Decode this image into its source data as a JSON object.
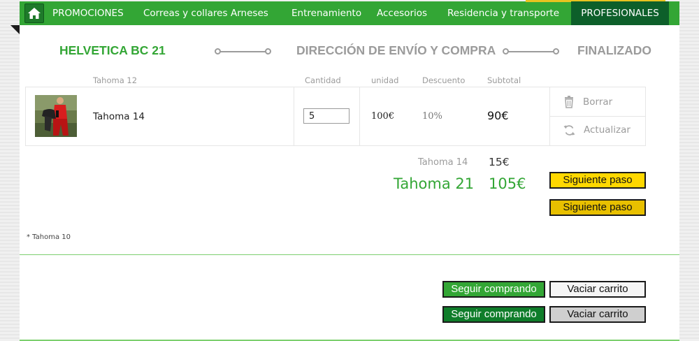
{
  "nav": {
    "home_icon": "home-icon",
    "items": [
      "PROMOCIONES",
      "Correas y collares",
      "Arneses",
      "Entrenamiento",
      "Accesorios",
      "Residencia y transporte"
    ],
    "professional": "PROFESIONALES",
    "colors": {
      "bar": "#33a635",
      "professional_bg": "#0d5f2a"
    }
  },
  "steps": {
    "step1": "HELVETICA BC 21",
    "step2": "DIRECCIÓN DE ENVÍO Y COMPRA",
    "step3": "FINALIZADO",
    "active_color": "#33a635",
    "inactive_color": "#9b9b9b"
  },
  "table": {
    "headers": {
      "product": "Tahoma 12",
      "quantity": "Cantidad",
      "unit": "unidad",
      "discount": "Descuento",
      "subtotal": "Subtotal"
    },
    "row": {
      "name": "Tahoma 14",
      "quantity": "5",
      "unit_price": "100€",
      "discount": "10%",
      "subtotal": "90€"
    },
    "actions": {
      "delete": "Borrar",
      "update": "Actualizar",
      "delete_icon": "trash-icon",
      "update_icon": "refresh-icon"
    }
  },
  "totals": {
    "shipping_label": "Tahoma 14",
    "shipping_value": "15€",
    "total_label": "Tahoma 21",
    "total_value": "105€"
  },
  "buttons": {
    "next": "Siguiente paso",
    "next_hover": "Siguiente paso",
    "continue": "Seguir comprando",
    "continue_hover": "Seguir comprando",
    "empty": "Vaciar carrito",
    "empty_hover": "Vaciar carrito"
  },
  "footnote": "* Tahoma 10"
}
